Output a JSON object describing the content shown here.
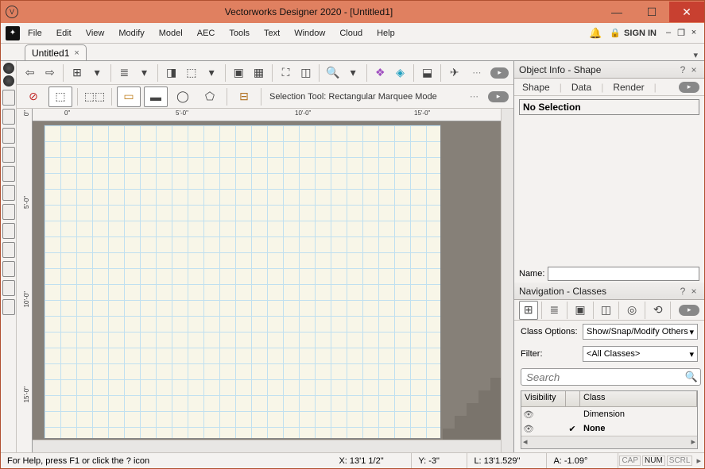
{
  "titlebar": {
    "title": "Vectorworks Designer 2020 - [Untitled1]"
  },
  "menubar": {
    "items": [
      "File",
      "Edit",
      "View",
      "Modify",
      "Model",
      "AEC",
      "Tools",
      "Text",
      "Window",
      "Cloud",
      "Help"
    ],
    "signin": "SIGN IN"
  },
  "tabs": {
    "doc": "Untitled1"
  },
  "toolbar2": {
    "desc": "Selection Tool: Rectangular Marquee Mode"
  },
  "hruler": {
    "ticks": [
      "0\"",
      "5'-0\"",
      "10'-0\"",
      "15'-0\""
    ]
  },
  "vruler": {
    "ticks": [
      "0\"",
      "5'-0\"",
      "10'-0\"",
      "15'-0\""
    ]
  },
  "object_info": {
    "title": "Object Info - Shape",
    "tabs": [
      "Shape",
      "Data",
      "Render"
    ],
    "no_selection": "No Selection",
    "name_label": "Name:",
    "name_value": ""
  },
  "navigation": {
    "title": "Navigation - Classes",
    "class_options_label": "Class Options:",
    "class_options_value": "Show/Snap/Modify Others",
    "filter_label": "Filter:",
    "filter_value": "<All Classes>",
    "search_placeholder": "Search",
    "cols": {
      "visibility": "Visibility",
      "class": "Class"
    },
    "rows": [
      {
        "name": "Dimension",
        "checked": false
      },
      {
        "name": "None",
        "checked": true
      }
    ]
  },
  "statusbar": {
    "help": "For Help, press F1 or click the ? icon",
    "x": "X: 13'1 1/2\"",
    "y": "Y: -3\"",
    "l": "L: 13'1.529\"",
    "a": "A: -1.09°",
    "cap": "CAP",
    "num": "NUM",
    "scrl": "SCRL"
  }
}
